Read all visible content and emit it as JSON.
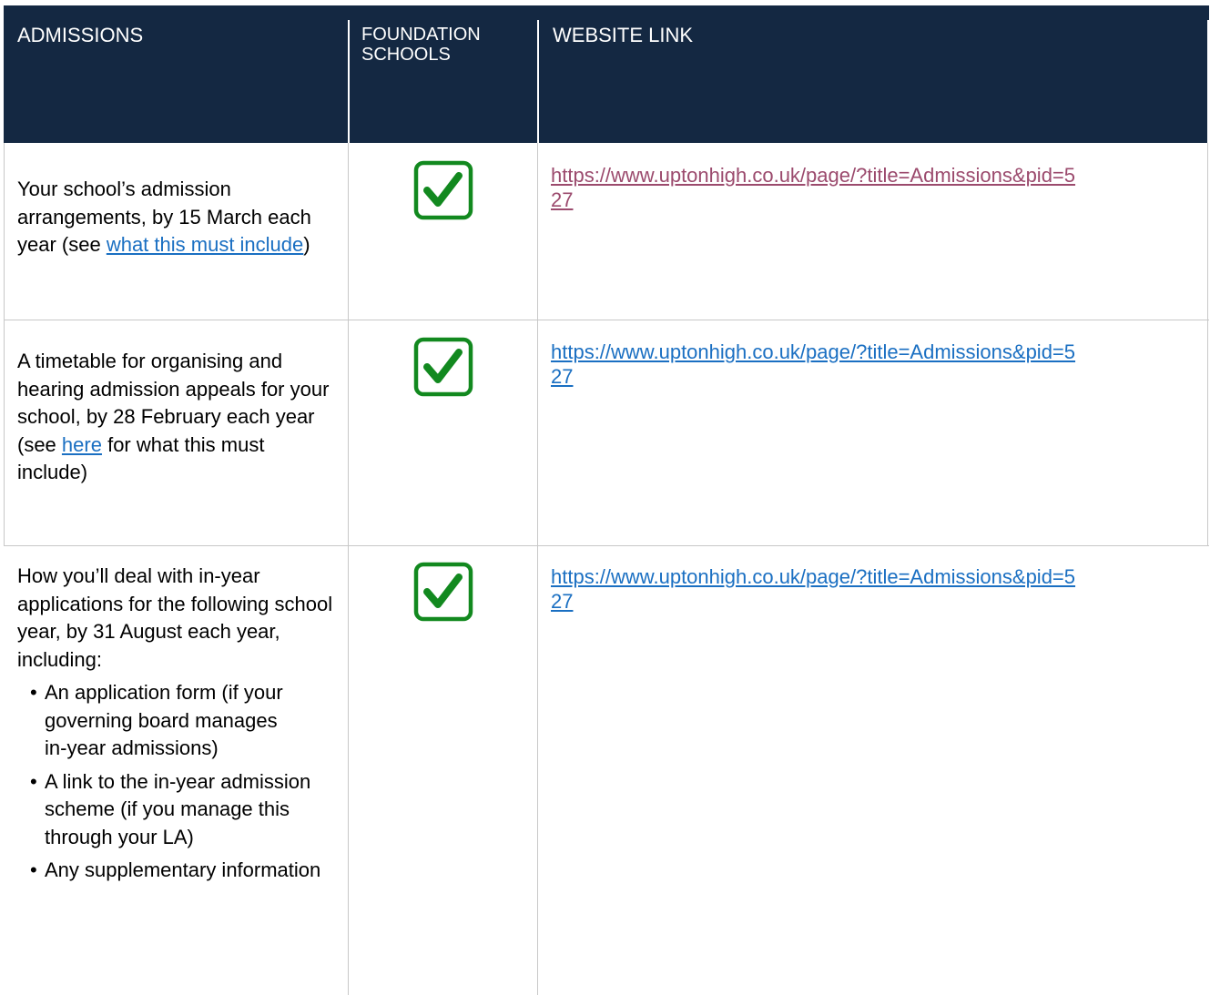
{
  "header": {
    "col1": "ADMISSIONS",
    "col2_line1": "FOUNDATION",
    "col2_line2": "SCHOOLS",
    "col3": "WEBSITE LINK"
  },
  "rows": [
    {
      "text_before": "Your school’s admission arrangements, by 15 March each year (see ",
      "link_text": "what this must include",
      "text_after": ")",
      "url_line1": "https://www.uptonhigh.co.uk/page/?title=Admissions&pid=5",
      "url_line2": "27",
      "check": "checked-box-icon"
    },
    {
      "text_before": "A timetable for organising and hearing admission appeals for your school, by 28 February each year (see ",
      "link_text": "here",
      "text_after": " for what this must include)",
      "url_line1": "https://www.uptonhigh.co.uk/page/?title=Admissions&pid=5",
      "url_line2": "27",
      "check": "checked-box-icon"
    },
    {
      "text": "How you’ll deal with in-year applications for the following school year, by 31 August each year, including:",
      "bullets": [
        "An application form (if your governing board manages",
        "in-year admissions)",
        "A link to the in-year admission scheme (if you manage this through your LA)",
        "Any supplementary information"
      ],
      "url_line1": "https://www.uptonhigh.co.uk/page/?title=Admissions&pid=5",
      "url_line2": "27",
      "check": "checked-box-icon"
    }
  ],
  "colors": {
    "header_bg": "#142842",
    "link": "#1a6fc2",
    "visited_link": "#9b4a6d",
    "check_green": "#12891f"
  }
}
